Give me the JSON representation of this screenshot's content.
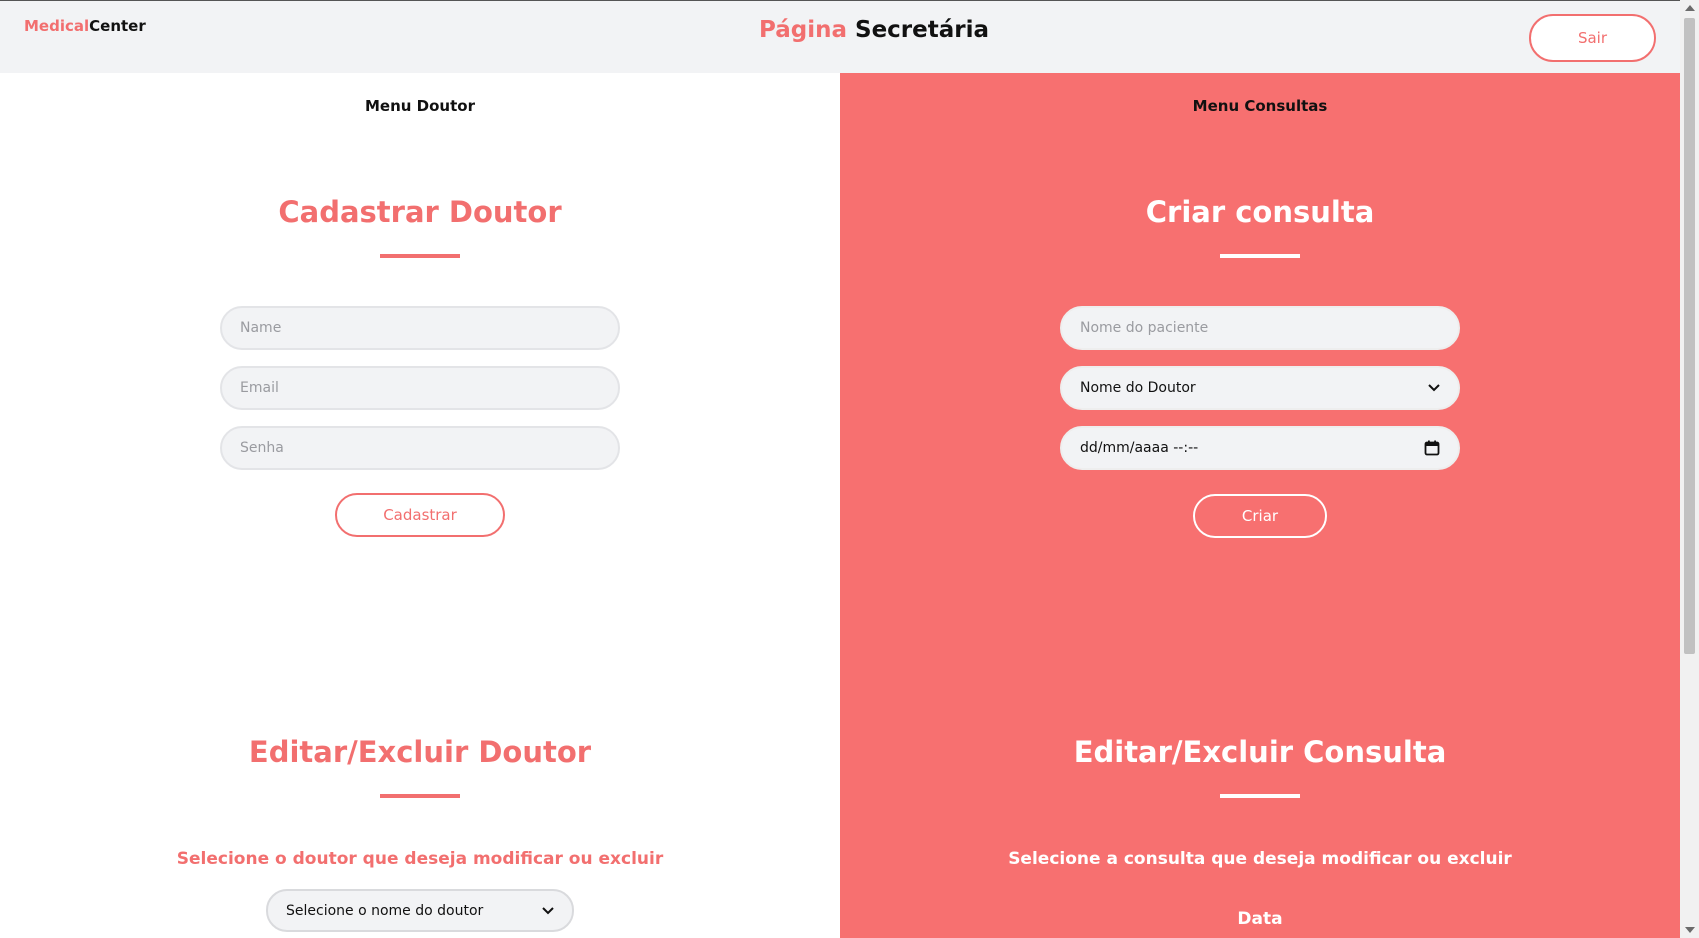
{
  "header": {
    "brand_part1": "Medical",
    "brand_part2": "Center",
    "title_part1": "Página",
    "title_part2": "Secretária",
    "logout_label": "Sair"
  },
  "left": {
    "menu_label": "Menu Doutor",
    "register_title": "Cadastrar Doutor",
    "name_placeholder": "Name",
    "email_placeholder": "Email",
    "password_placeholder": "Senha",
    "register_button": "Cadastrar",
    "edit_title": "Editar/Excluir Doutor",
    "edit_subtitle": "Selecione o doutor que deseja modificar ou excluir",
    "doctor_select_value": "Selecione o nome do doutor"
  },
  "right": {
    "menu_label": "Menu Consultas",
    "create_title": "Criar consulta",
    "patient_placeholder": "Nome do paciente",
    "doctor_select_value": "Nome do Doutor",
    "datetime_placeholder": "dd/mm/aaaa  --:--",
    "create_button": "Criar",
    "edit_title": "Editar/Excluir Consulta",
    "edit_subtitle": "Selecione a consulta que deseja modificar ou excluir",
    "date_label": "Data"
  },
  "colors": {
    "accent": "#f26f6f",
    "panel_right_bg": "#f77070",
    "header_bg": "#f2f3f5"
  }
}
